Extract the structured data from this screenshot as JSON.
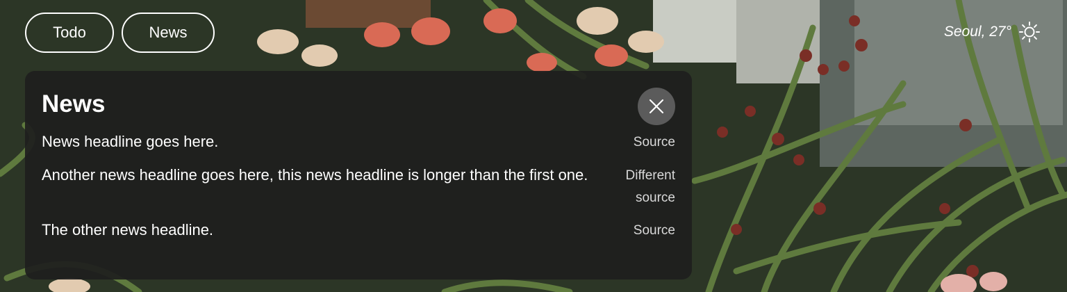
{
  "nav": {
    "todo_label": "Todo",
    "news_label": "News"
  },
  "weather": {
    "text": "Seoul, 27°",
    "icon": "sun-icon"
  },
  "news_panel": {
    "title": "News",
    "close_icon": "close-icon",
    "items": [
      {
        "headline": "News headline goes here.",
        "source": "Source"
      },
      {
        "headline": "Another news headline goes here, this news headline is longer than the first one.",
        "source": "Different source"
      },
      {
        "headline": "The other news headline.",
        "source": "Source"
      }
    ]
  },
  "colors": {
    "panel_bg": "#1e1e1e",
    "close_bg": "#5b5b5b",
    "text": "#ffffff",
    "muted_text": "#d9d9d9"
  }
}
